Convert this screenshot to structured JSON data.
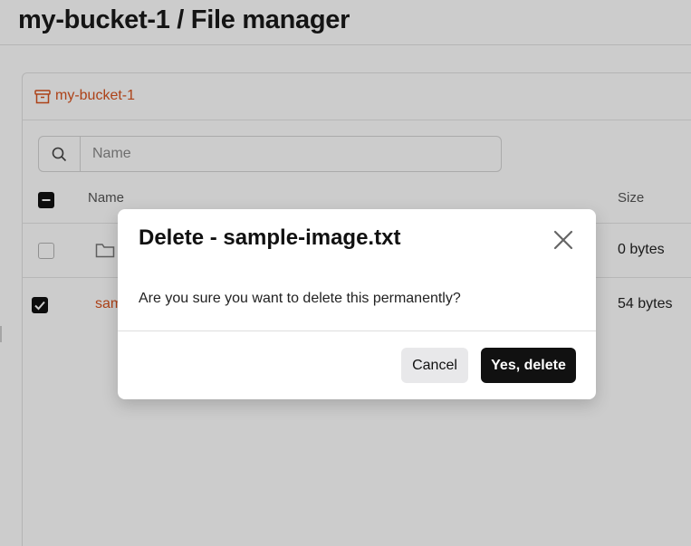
{
  "header": {
    "title": "my-bucket-1 / File manager"
  },
  "bucket": {
    "label": "my-bucket-1",
    "icon": "archive-box-icon"
  },
  "search": {
    "placeholder": "Name",
    "value": ""
  },
  "table": {
    "columns": {
      "name": "Name",
      "size": "Size"
    },
    "rows": [
      {
        "type": "folder",
        "name": "",
        "size": "0 bytes",
        "selected": false
      },
      {
        "type": "file",
        "name": "sam",
        "size": "54 bytes",
        "selected": true
      }
    ]
  },
  "dialog": {
    "title": "Delete - sample-image.txt",
    "message": "Are you sure you want to delete this permanently?",
    "cancel_label": "Cancel",
    "confirm_label": "Yes, delete"
  },
  "colors": {
    "accent": "#d9531e",
    "primary_button": "#111111",
    "secondary_button": "#e8e8ea",
    "overlay": "rgba(0,0,0,0.2)"
  }
}
